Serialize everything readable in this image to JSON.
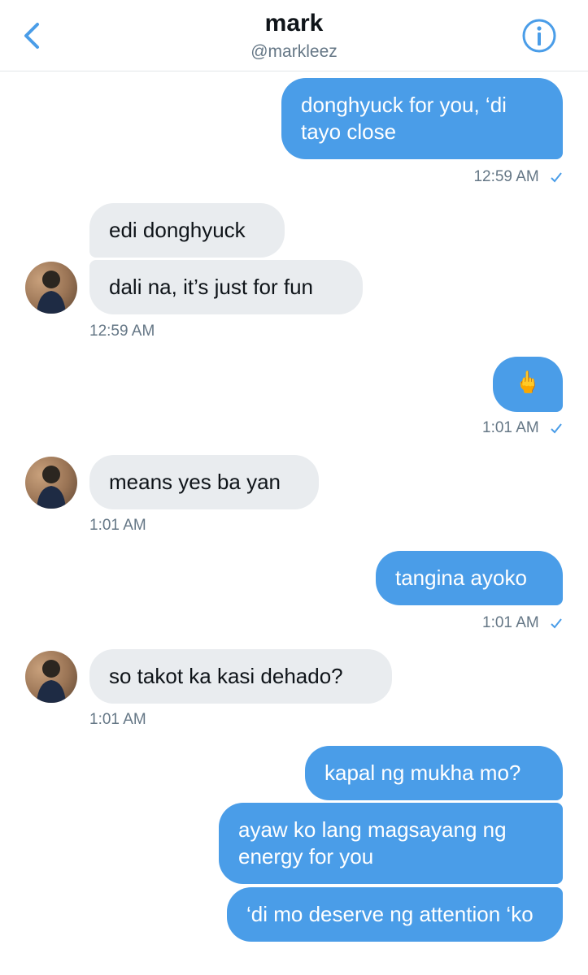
{
  "header": {
    "name": "mark",
    "handle": "@markleez",
    "back_icon": "chevron-left-icon",
    "info_icon": "info-icon"
  },
  "colors": {
    "outgoing_bubble": "#4a9de8",
    "incoming_bubble": "#e9ecef",
    "accent": "#4a9de8"
  },
  "messages": [
    {
      "from": "me",
      "text": "donghyuck for you, ‘di tayo close"
    },
    {
      "from": "me",
      "time": "12:59 AM"
    },
    {
      "from": "mark",
      "text": "edi donghyuck"
    },
    {
      "from": "mark",
      "text": "dali na, it’s just for fun"
    },
    {
      "from": "mark",
      "time": "12:59 AM"
    },
    {
      "from": "me",
      "text": "🖕"
    },
    {
      "from": "me",
      "time": "1:01 AM"
    },
    {
      "from": "mark",
      "text": "means yes ba yan"
    },
    {
      "from": "mark",
      "time": "1:01 AM"
    },
    {
      "from": "me",
      "text": "tangina ayoko"
    },
    {
      "from": "me",
      "time": "1:01 AM"
    },
    {
      "from": "mark",
      "text": "so takot ka kasi dehado?"
    },
    {
      "from": "mark",
      "time": "1:01 AM"
    },
    {
      "from": "me",
      "text": "kapal ng mukha mo?"
    },
    {
      "from": "me",
      "text": "ayaw ko lang magsayang ng energy for you"
    },
    {
      "from": "me",
      "text": "‘di mo deserve ng attention ‘ko"
    }
  ]
}
